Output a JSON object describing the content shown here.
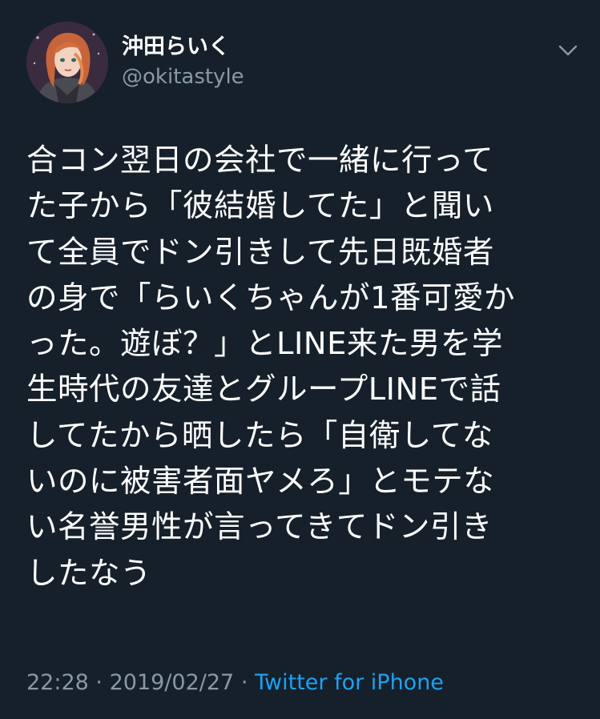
{
  "user": {
    "display_name": "沖田らいく",
    "handle": "@okitastyle",
    "avatar_icon": "avatar-illustration"
  },
  "menu_icon": "chevron-down-icon",
  "tweet": {
    "text": "合コン翌日の会社で一緒に行って\nた子から「彼結婚してた」と聞い\nて全員でドン引きして先日既婚者\nの身で「らいくちゃんが1番可愛か\nった。遊ぼ？」とLINE来た男を学\n生時代の友達とグループLINEで話\nしてたから晒したら「自衛してな\nいのに被害者面ヤメろ」とモテな\nい名誉男性が言ってきてドン引き\nしたなう",
    "time": "22:28",
    "separator": "·",
    "date": "2019/02/27",
    "source": "Twitter for iPhone"
  },
  "colors": {
    "background": "#15202b",
    "text": "#ffffff",
    "secondary": "#8899a6",
    "link": "#1da1f2"
  }
}
